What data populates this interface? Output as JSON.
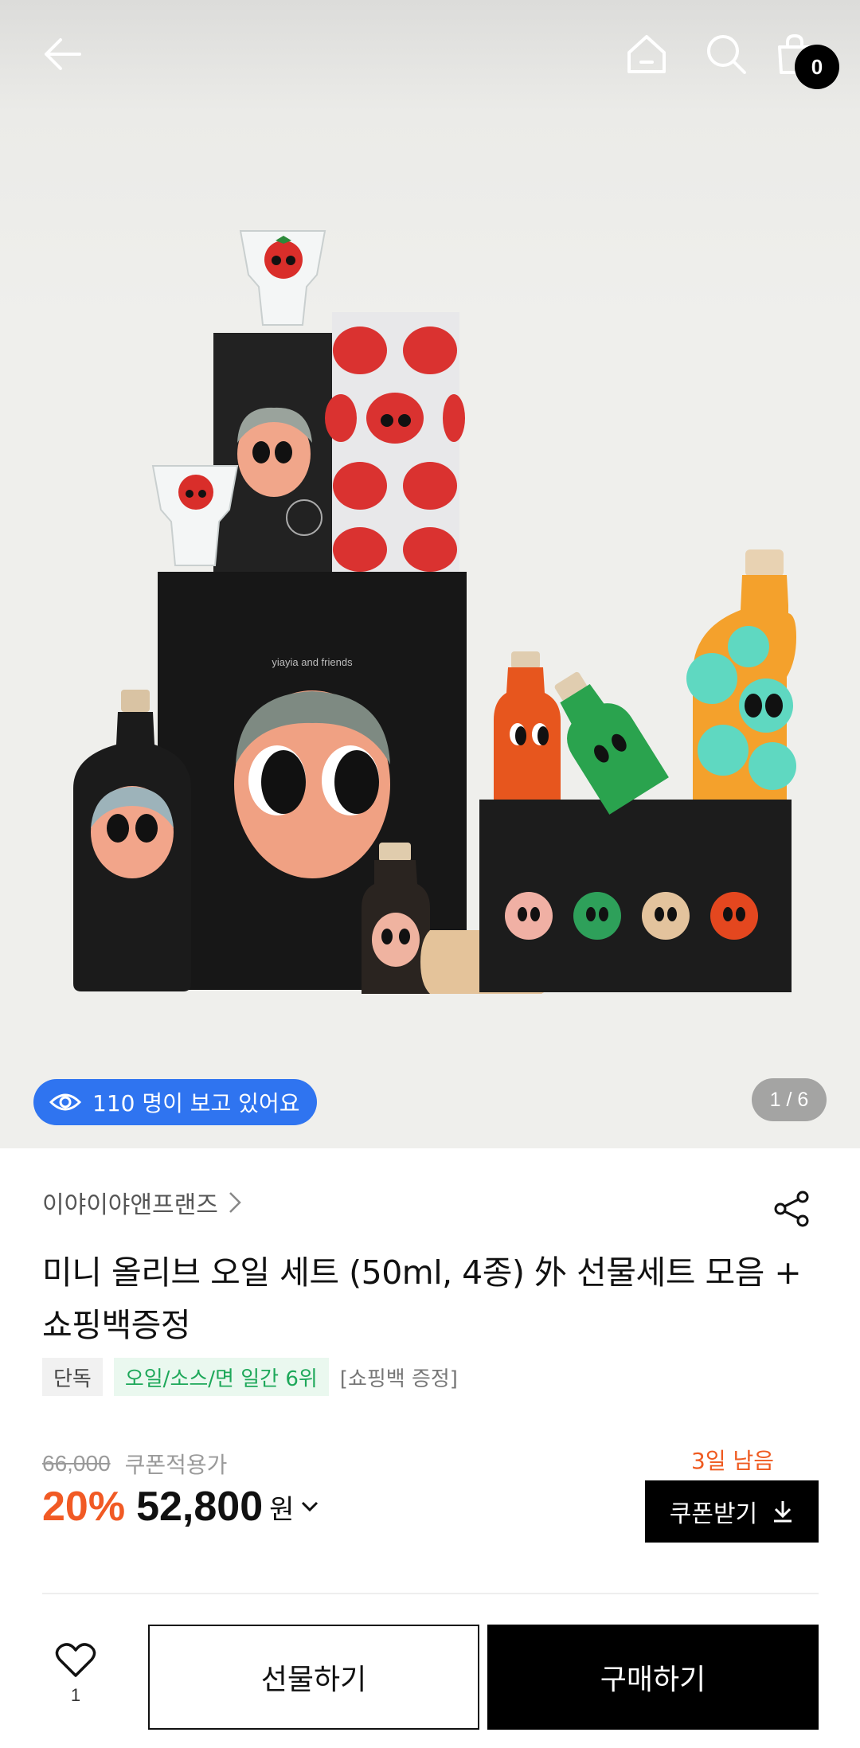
{
  "header": {
    "back_icon": "arrow-left-icon",
    "home_icon": "home-icon",
    "search_icon": "search-icon",
    "cart_icon": "shopping-bag-icon",
    "cart_count": "0"
  },
  "gallery": {
    "viewers_text": "110 명이 보고 있어요",
    "viewers_icon": "eye-icon",
    "pager": "1 / 6",
    "box_label": "yiayia and friends"
  },
  "product": {
    "brand": "이야이야앤프랜즈",
    "title": "미니 올리브 오일 세트 (50ml, 4종) 外 선물세트 모음 + 쇼핑백증정",
    "tags": [
      "단독",
      "오일/소스/면 일간 6위",
      "[쇼핑백 증정]"
    ]
  },
  "price": {
    "original": "66,000",
    "coupon_label": "쿠폰적용가",
    "discount": "20%",
    "value": "52,800",
    "unit": "원",
    "days_left": "3일 남음",
    "coupon_button": "쿠폰받기"
  },
  "bottom_bar": {
    "like_count": "1",
    "gift_button": "선물하기",
    "buy_button": "구매하기"
  },
  "colors": {
    "accent_blue": "#2f74f0",
    "discount_orange": "#f15a24",
    "tag_green": "#1ea85a",
    "black": "#000000"
  }
}
